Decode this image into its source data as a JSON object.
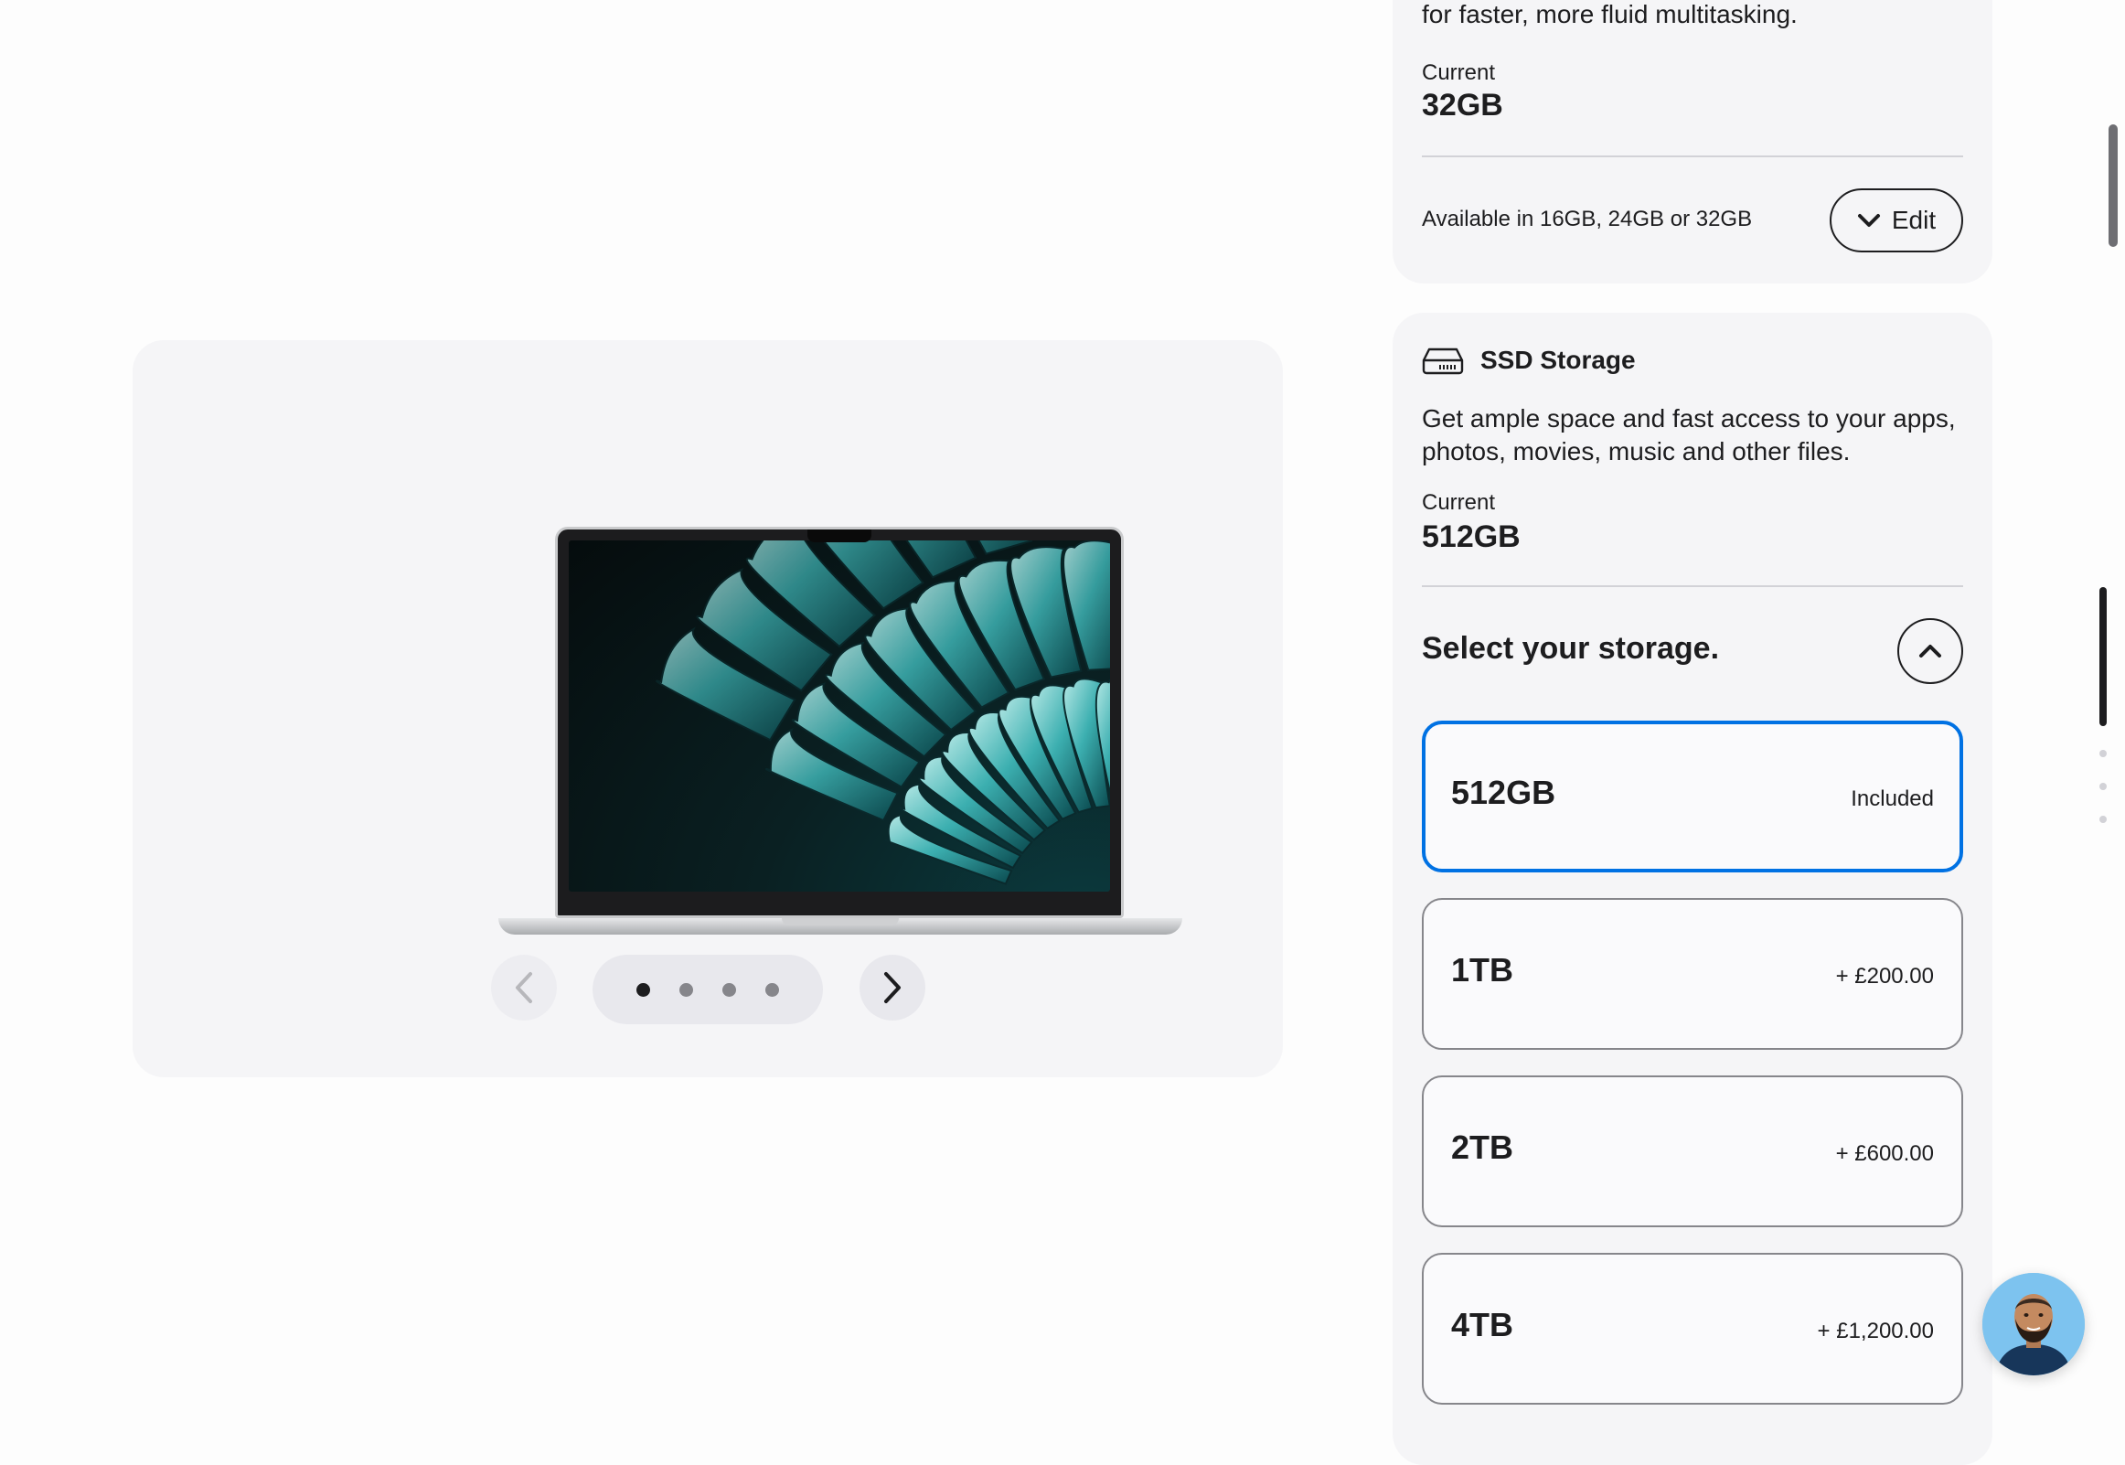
{
  "gallery": {
    "image_alt": "MacBook Air",
    "dot_count": 4,
    "active_dot": 1
  },
  "memory": {
    "description_line": "for faster, more fluid multitasking.",
    "current_label": "Current",
    "current_value": "32GB",
    "available_text": "Available in 16GB, 24GB or 32GB",
    "edit_label": "Edit"
  },
  "ssd": {
    "title": "SSD Storage",
    "description": "Get ample space and fast access to your apps, photos, movies, music and other files.",
    "current_label": "Current",
    "current_value": "512GB",
    "select_title": "Select your storage.",
    "options": [
      {
        "size": "512GB",
        "price": "Included",
        "selected": true
      },
      {
        "size": "1TB",
        "price": "+ £200.00",
        "selected": false
      },
      {
        "size": "2TB",
        "price": "+ £600.00",
        "selected": false
      },
      {
        "size": "4TB",
        "price": "+ £1,200.00",
        "selected": false
      }
    ]
  },
  "colors": {
    "accent": "#0071e3",
    "card_bg": "#f5f5f7",
    "text": "#1d1d1f"
  },
  "icons": {
    "prev": "chevron-left-icon",
    "next": "chevron-right-icon",
    "edit": "chevron-down-icon",
    "collapse": "chevron-up-icon",
    "ssd": "drive-icon"
  }
}
